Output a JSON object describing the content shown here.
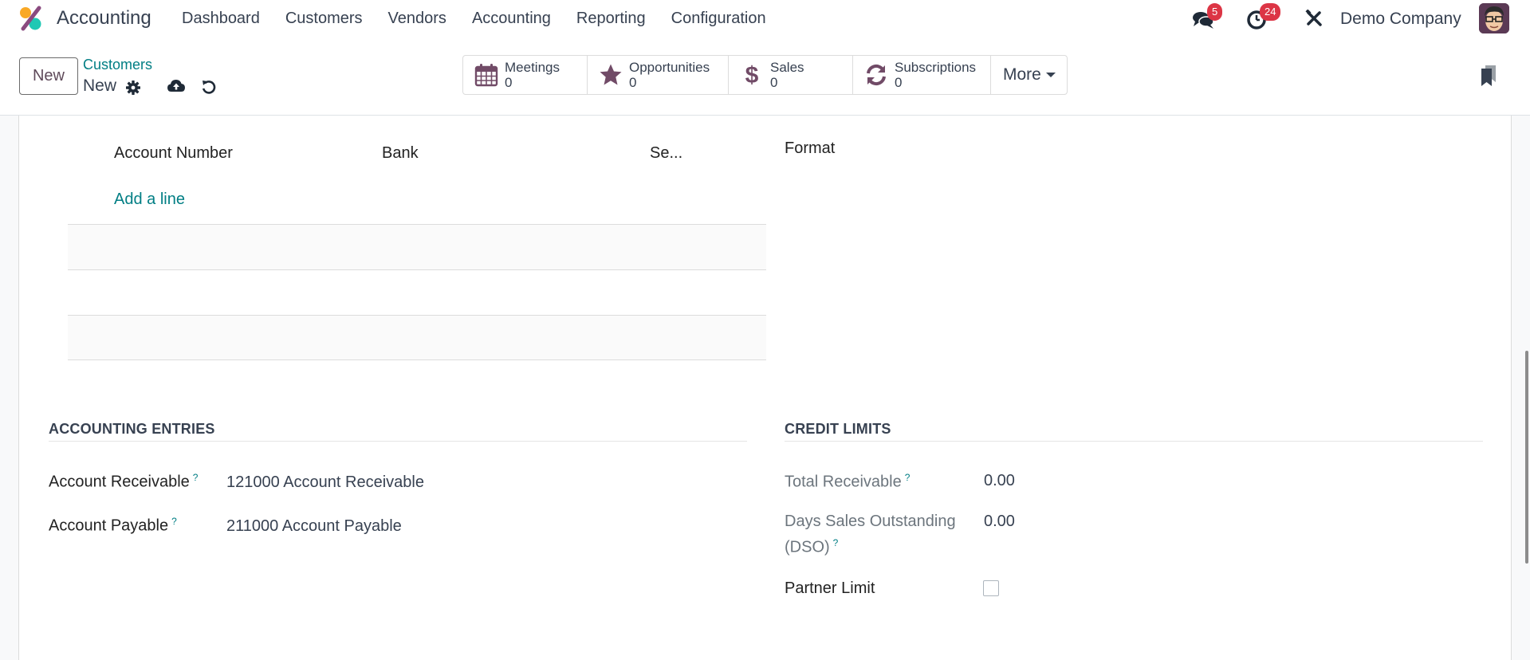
{
  "navbar": {
    "app_name": "Accounting",
    "menu": [
      "Dashboard",
      "Customers",
      "Vendors",
      "Accounting",
      "Reporting",
      "Configuration"
    ],
    "messages_badge": "5",
    "activities_badge": "24",
    "company": "Demo Company",
    "icons": {
      "messages": "chat-bubbles-icon",
      "activities": "clock-icon",
      "debug": "tools-icon",
      "avatar": "user-avatar"
    },
    "colors": {
      "badge": "#dc3545",
      "accent": "#017e84",
      "brand": "#714b67"
    }
  },
  "control_panel": {
    "new_button": "New",
    "breadcrumb_parent": "Customers",
    "breadcrumb_current": "New",
    "smart_buttons": [
      {
        "label": "Meetings",
        "value": "0",
        "icon": "calendar-icon"
      },
      {
        "label": "Opportunities",
        "value": "0",
        "icon": "star-icon"
      },
      {
        "label": "Sales",
        "value": "0",
        "icon": "dollar-icon"
      },
      {
        "label": "Subscriptions",
        "value": "0",
        "icon": "refresh-icon"
      }
    ],
    "more_label": "More"
  },
  "bank_accounts": {
    "columns": [
      "Account Number",
      "Bank",
      "Se..."
    ],
    "add_line": "Add a line",
    "format_label": "Format"
  },
  "accounting_entries": {
    "title": "ACCOUNTING ENTRIES",
    "fields": [
      {
        "label": "Account Receivable",
        "help": "?",
        "value": "121000 Account Receivable"
      },
      {
        "label": "Account Payable",
        "help": "?",
        "value": "211000 Account Payable"
      }
    ]
  },
  "credit_limits": {
    "title": "CREDIT LIMITS",
    "total_receivable": {
      "label": "Total Receivable",
      "help": "?",
      "value": "0.00"
    },
    "dso": {
      "label_line1": "Days Sales Outstanding",
      "label_line2": "(DSO)",
      "help": "?",
      "value": "0.00"
    },
    "partner_limit": {
      "label": "Partner Limit",
      "checked": false
    }
  }
}
